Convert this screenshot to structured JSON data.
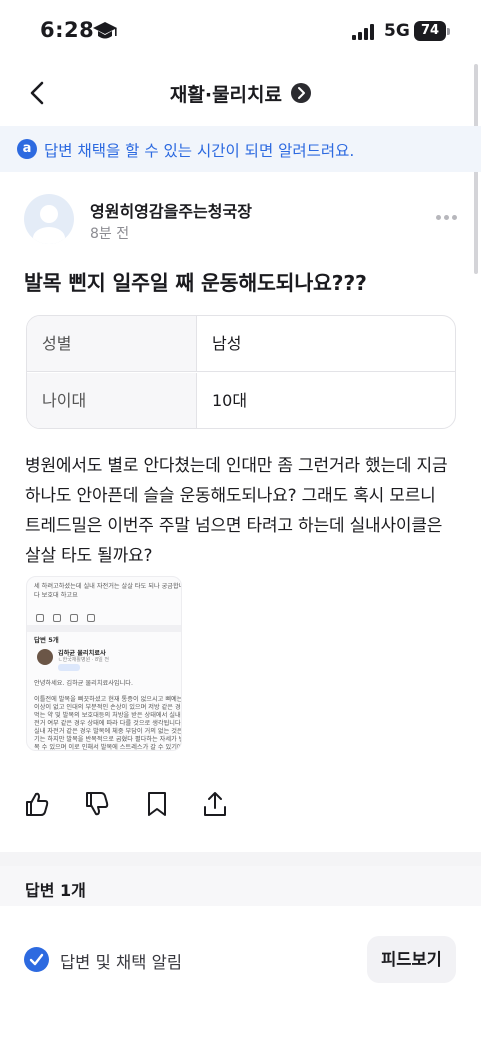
{
  "status_bar": {
    "time": "6:28",
    "network": "5G",
    "battery": "74"
  },
  "header": {
    "title": "재활·물리치료"
  },
  "notice": {
    "icon_letter": "a",
    "text": "답변 채택을 할 수 있는 시간이 되면 알려드려요."
  },
  "author": {
    "name": "영원히영감을주는청국장",
    "time": "8분 전"
  },
  "question": {
    "title": "발목 삔지 일주일 째 운동해도되나요???",
    "info": [
      {
        "key": "성별",
        "value": "남성"
      },
      {
        "key": "나이대",
        "value": "10대"
      }
    ],
    "body": "병원에서도 별로 안다쳤는데 인대만 좀 그런거라 했는데 지금 하나도 안아픈데 슬슬 운동해도되나요? 그래도 혹시 모르니 트레드밀은 이번주 주말 넘으면 타려고 하는데 실내사이클은 살살 타도 될까요?"
  },
  "attachment": {
    "lines_top": [
      "세 하려고하셨는데  실내 자전거는 살살 타도 되나 궁금합니",
      "다 보호대 하고요"
    ],
    "answer_label": "답변 5개",
    "expert_name": "김하균 물리치료사",
    "expert_sub": "ㄴ한국재활병원 · 8일 전",
    "lines_body": [
      "안녕하세요. 김하균 물리치료사입니다.",
      "",
      "이틀전에 발목을 삐끗하셨고 현재 통증이 없으시고 삐예는",
      "이상이 없고 인대의 부분적인 손상이 있으며 저방 같은 경우",
      "먹는 약 및 발목의 보호대등의 처방을 받은 상태에서 실내 자",
      "전거 여부 같은 경우 상태에 따라 다를 것으로 생각됩니다.",
      "실내 자전거 같은 경우 발목에 체중 부담이 거의 없는 것은 맞",
      "기는 하지만 발목을 반복적으로 굽혔다 펼다하는 자세가 반",
      "복 수 있으며 이로 인해서 발목에 스트레스가 갈 수 있기에"
    ]
  },
  "actions": [
    "like-icon",
    "dislike-icon",
    "bookmark-icon",
    "share-icon"
  ],
  "answers": {
    "label": "답변 1개"
  },
  "notify": {
    "label": "답변 및 채택 알림",
    "feed_button": "피드보기"
  },
  "colors": {
    "accent": "#2d6ae0",
    "notice_bg": "#f1f5fb",
    "text": "#1b1b1f",
    "muted": "#8c8c92"
  }
}
